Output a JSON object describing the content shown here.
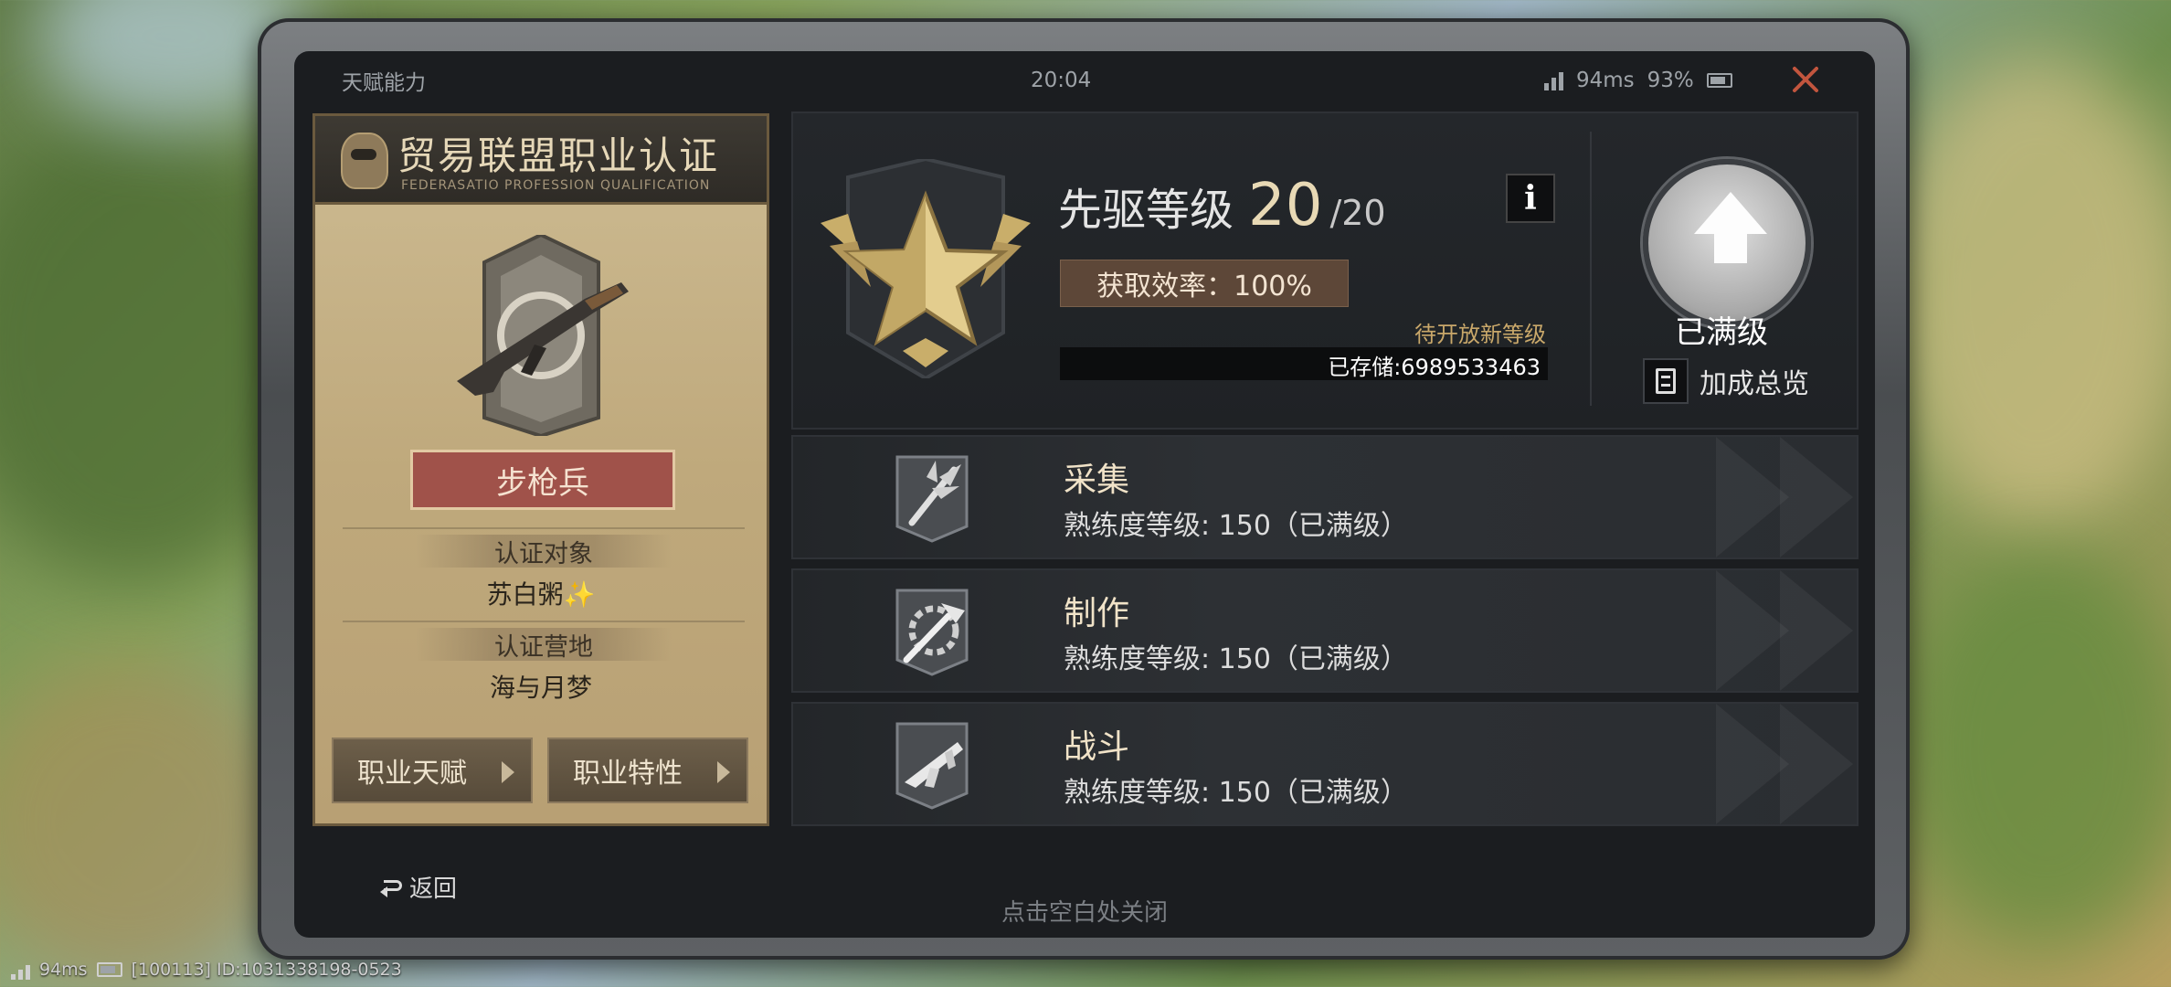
{
  "status": {
    "title": "天赋能力",
    "time": "20:04",
    "ping": "94ms",
    "battery": "93%"
  },
  "certificate": {
    "title": "贸易联盟职业认证",
    "subtitle": "FEDERASATIO PROFESSION QUALIFICATION",
    "role": "步枪兵",
    "target_label": "认证对象",
    "target_value": "苏白粥✨",
    "camp_label": "认证营地",
    "camp_value": "海与月梦",
    "btn_talent": "职业天赋",
    "btn_trait": "职业特性"
  },
  "rank": {
    "title": "先驱等级",
    "level": "20",
    "max": "/20",
    "info": "i",
    "efficiency": "获取效率：100%",
    "pending": "待开放新等级",
    "stored": "已存储:6989533463",
    "maxed": "已满级",
    "bonus": "加成总览"
  },
  "skills": [
    {
      "name": "采集",
      "detail": "熟练度等级: 150（已满级）"
    },
    {
      "name": "制作",
      "detail": "熟练度等级: 150（已满级）"
    },
    {
      "name": "战斗",
      "detail": "熟练度等级: 150（已满级）"
    }
  ],
  "nav": {
    "back": "返回",
    "hint": "点击空白处关闭"
  },
  "footer": {
    "ping": "94ms",
    "ids": "[100113] ID:1031338198-0523"
  },
  "colors": {
    "accent_gold": "#e8d9b5",
    "role_red": "#a0524a",
    "close_red": "#c2553e",
    "pending_orange": "#c9a86a"
  }
}
